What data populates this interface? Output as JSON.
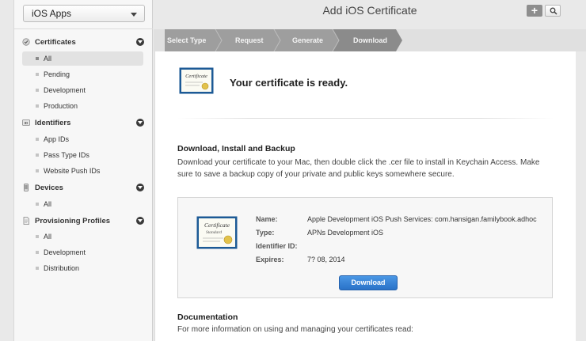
{
  "app_selector": {
    "label": "iOS Apps"
  },
  "sidebar": {
    "sections": [
      {
        "label": "Certificates",
        "items": [
          "All",
          "Pending",
          "Development",
          "Production"
        ]
      },
      {
        "label": "Identifiers",
        "items": [
          "App IDs",
          "Pass Type IDs",
          "Website Push IDs"
        ]
      },
      {
        "label": "Devices",
        "items": [
          "All"
        ]
      },
      {
        "label": "Provisioning Profiles",
        "items": [
          "All",
          "Development",
          "Distribution"
        ]
      }
    ],
    "identifiers_icon_text": "ID"
  },
  "header": {
    "title": "Add iOS Certificate",
    "add_label": "+"
  },
  "steps": [
    "Select Type",
    "Request",
    "Generate",
    "Download"
  ],
  "ready": {
    "message": "Your certificate is ready.",
    "cert_word": "Certificate"
  },
  "download_section": {
    "heading": "Download, Install and Backup",
    "description": "Download your certificate to your Mac, then double click the .cer file to install in Keychain Access. Make sure to save a backup copy of your private and public keys somewhere secure."
  },
  "certificate": {
    "image_title": "Certificate",
    "image_subtitle": "Standard",
    "fields": [
      {
        "label": "Name:",
        "value": "Apple Development iOS Push Services: com.hansigan.familybook.adhoc"
      },
      {
        "label": "Type:",
        "value": "APNs Development iOS"
      },
      {
        "label": "Identifier ID:",
        "value": ""
      },
      {
        "label": "Expires:",
        "value": "7? 08, 2014"
      }
    ],
    "download_label": "Download"
  },
  "documentation": {
    "heading": "Documentation",
    "description": "For more information on using and managing your certificates read:"
  },
  "colors": {
    "accent": "#2a72c8",
    "step_active": "#8b8b8b",
    "step_inactive": "#9e9e9e"
  }
}
